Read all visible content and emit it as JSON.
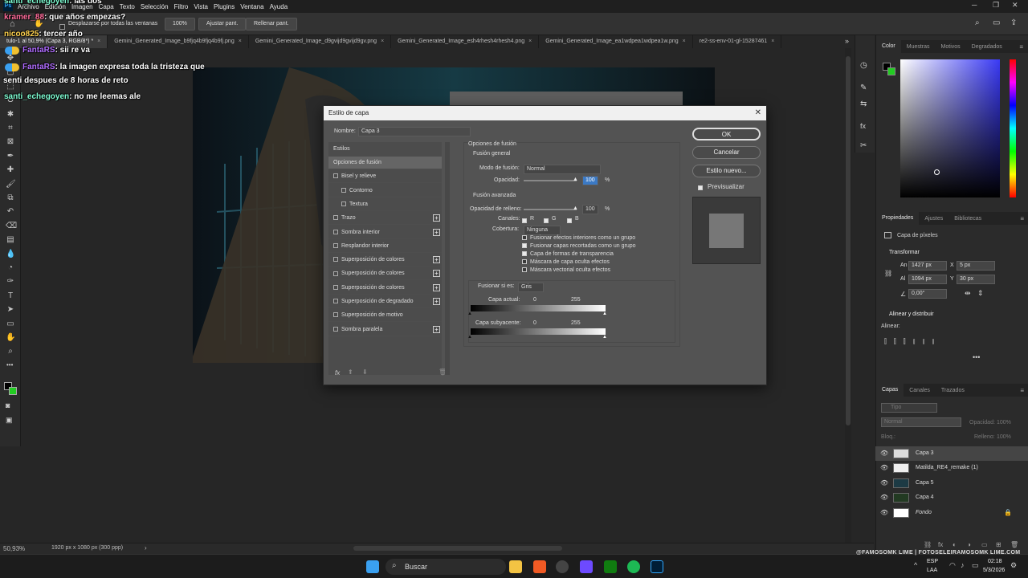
{
  "menubar": {
    "items": [
      "Archivo",
      "Edición",
      "Imagen",
      "Capa",
      "Texto",
      "Selección",
      "Filtro",
      "Vista",
      "Plugins",
      "Ventana",
      "Ayuda"
    ]
  },
  "options": {
    "scroll_all_label": "Desplazarse por todas las ventanas",
    "zoom_btn": "100%",
    "fit_btn": "Ajustar pant.",
    "fill_btn": "Rellenar pant."
  },
  "tabs": [
    "tulo-1 al 50,9% (Capa 3, RGB/8*) *",
    "Gemini_Generated_Image_b9fjq4b9fjq4b9fj.png",
    "Gemini_Generated_Image_d9gvijd9gvijd9gv.png",
    "Gemini_Generated_Image_esh4rhesh4rhesh4.png",
    "Gemini_Generated_Image_ea1wdpea1wdpea1w.png",
    "re2-ss-env-01-gl-15287461"
  ],
  "chat": [
    {
      "user": "santi_echegoyen",
      "msg": ": las dos",
      "color": "#7fffd4"
    },
    {
      "user": "kramer_88",
      "msg": ": que años empezas?",
      "color": "#ff6b9a"
    },
    {
      "user": "nicoo825",
      "msg": ": tercer año",
      "color": "#ffd24d"
    },
    {
      "user": "FantaRS",
      "msg": ": sii re va",
      "color": "#b06cff"
    },
    {
      "user": "FantaRS",
      "msg": ": la imagen expresa toda la tristeza que",
      "color": "#b06cff"
    },
    {
      "user": "",
      "msg": "senti despues de 8 horas de reto",
      "color": "#fff"
    },
    {
      "user": "santi_echegoyen",
      "msg": ": no me leemas ale",
      "color": "#7fffd4"
    }
  ],
  "status": {
    "zoom": "50,93%",
    "dims": "1920 px x 1080 px (300 ppp)"
  },
  "dialog": {
    "title": "Estilo de capa",
    "name_label": "Nombre:",
    "name_value": "Capa 3",
    "styles_header": "Estilos",
    "styles": [
      {
        "label": "Opciones de fusión",
        "check": false,
        "plus": false,
        "active": true,
        "indent": false
      },
      {
        "label": "Bisel y relieve",
        "check": true,
        "plus": false,
        "indent": false
      },
      {
        "label": "Contorno",
        "check": true,
        "plus": false,
        "indent": true
      },
      {
        "label": "Textura",
        "check": true,
        "plus": false,
        "indent": true
      },
      {
        "label": "Trazo",
        "check": true,
        "plus": true,
        "indent": false
      },
      {
        "label": "Sombra interior",
        "check": true,
        "plus": true,
        "indent": false
      },
      {
        "label": "Resplandor interior",
        "check": true,
        "plus": false,
        "indent": false
      },
      {
        "label": "Superposición de colores",
        "check": true,
        "plus": true,
        "indent": false
      },
      {
        "label": "Superposición de colores",
        "check": true,
        "plus": true,
        "indent": false
      },
      {
        "label": "Superposición de colores",
        "check": true,
        "plus": true,
        "indent": false
      },
      {
        "label": "Superposición de degradado",
        "check": true,
        "plus": true,
        "indent": false
      },
      {
        "label": "Superposición de motivo",
        "check": true,
        "plus": false,
        "indent": false
      },
      {
        "label": "Sombra paralela",
        "check": true,
        "plus": true,
        "indent": false
      }
    ],
    "fx_label": "fx",
    "section_title": "Opciones de fusión",
    "general_title": "Fusión general",
    "blend_mode_label": "Modo de fusión:",
    "blend_mode_value": "Normal",
    "opacity_label": "Opacidad:",
    "opacity_value": "100",
    "percent": "%",
    "advanced_title": "Fusión avanzada",
    "fill_label": "Opacidad de relleno:",
    "fill_value": "100",
    "channels_label": "Canales:",
    "ch_r": "R",
    "ch_g": "G",
    "ch_b": "B",
    "knockout_label": "Cobertura:",
    "knockout_value": "Ninguna",
    "options": [
      {
        "label": "Fusionar efectos interiores como un grupo",
        "on": false
      },
      {
        "label": "Fusionar capas recortadas como un grupo",
        "on": true
      },
      {
        "label": "Capa de formas de transparencia",
        "on": true
      },
      {
        "label": "Máscara de capa oculta efectos",
        "on": false
      },
      {
        "label": "Máscara vectorial oculta efectos",
        "on": false
      }
    ],
    "blend_if_label": "Fusionar si es:",
    "blend_if_value": "Gris",
    "this_layer_label": "Capa actual:",
    "under_layer_label": "Capa subyacente:",
    "range_min": "0",
    "range_max": "255",
    "ok": "OK",
    "cancel": "Cancelar",
    "new_style": "Estilo nuevo...",
    "preview_label": "Previsualizar"
  },
  "panels": {
    "color_tabs": [
      "Color",
      "Muestras",
      "Motivos",
      "Degradados"
    ],
    "prop_tabs": [
      "Propiedades",
      "Ajustes",
      "Bibliotecas"
    ],
    "prop_type": "Capa de píxeles",
    "transform_title": "Transformar",
    "w_label": "An",
    "w_value": "1427 px",
    "x_label": "X",
    "x_value": "5 px",
    "h_label": "Al",
    "h_value": "1094 px",
    "y_label": "Y",
    "y_value": "30 px",
    "angle_value": "0,00°",
    "align_title": "Alinear y distribuir",
    "align_label": "Alinear:",
    "layer_tabs": [
      "Capas",
      "Canales",
      "Trazados"
    ],
    "search_placeholder": "Tipo",
    "blend_value": "Normal",
    "opacity_label": "Opacidad:",
    "opacity_value": "100%",
    "lock_label": "Bloq.:",
    "fill_label": "Relleno:",
    "fill_value": "100%",
    "layers": [
      "Capa 3",
      "Matilda_RE4_remake (1)",
      "Capa 5",
      "Capa 4",
      "Fondo"
    ]
  },
  "taskbar": {
    "search": "Buscar",
    "lang": "ESP",
    "region": "LAA",
    "time": "02:18",
    "date": "5/3/2026",
    "overlay_text": "@FAMOSOMK LIME | FOTOSELEIRAMOSOMK LIME.COM"
  }
}
